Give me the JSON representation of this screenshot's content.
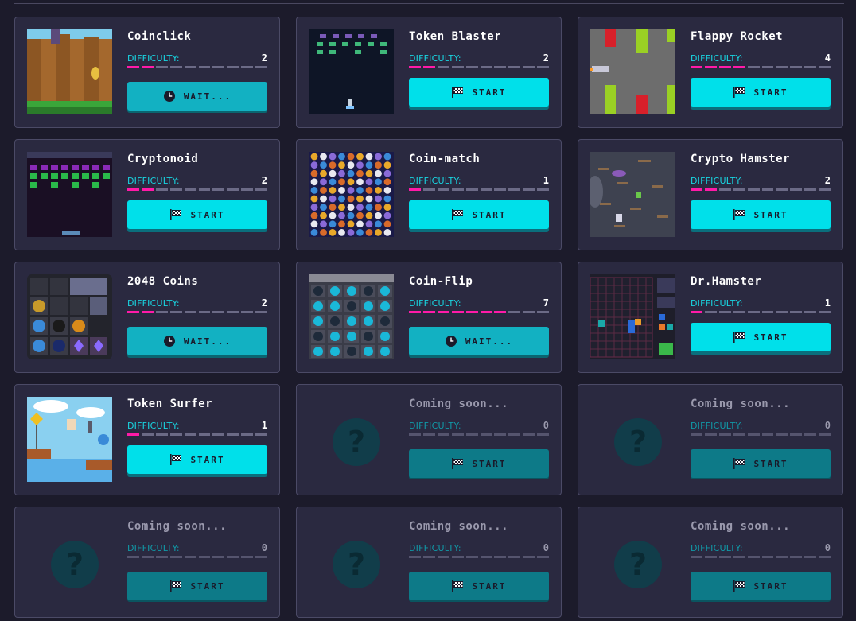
{
  "difficulty_label": "DIFFICULTY:",
  "colors": {
    "background": "#1c1b2b",
    "card": "#2a2940",
    "accent": "#00e0ea",
    "difficulty_on": "#ff1aa8"
  },
  "games": [
    {
      "title": "Coinclick",
      "difficulty": "2",
      "level": 2,
      "button": "WAIT...",
      "state": "wait",
      "thumb": "coinclick-art"
    },
    {
      "title": "Token Blaster",
      "difficulty": "2",
      "level": 2,
      "button": "START",
      "state": "start",
      "thumb": "space-shooter-art"
    },
    {
      "title": "Flappy Rocket",
      "difficulty": "4",
      "level": 4,
      "button": "START",
      "state": "start",
      "thumb": "pipes-art"
    },
    {
      "title": "Cryptonoid",
      "difficulty": "2",
      "level": 2,
      "button": "START",
      "state": "start",
      "thumb": "breakout-art"
    },
    {
      "title": "Coin-match",
      "difficulty": "1",
      "level": 1,
      "button": "START",
      "state": "start",
      "thumb": "match-grid-art"
    },
    {
      "title": "Crypto Hamster",
      "difficulty": "2",
      "level": 2,
      "button": "START",
      "state": "start",
      "thumb": "platform-art"
    },
    {
      "title": "2048 Coins",
      "difficulty": "2",
      "level": 2,
      "button": "WAIT...",
      "state": "wait",
      "thumb": "2048-grid-art"
    },
    {
      "title": "Coin-Flip",
      "difficulty": "7",
      "level": 7,
      "button": "WAIT...",
      "state": "wait",
      "thumb": "flip-grid-art"
    },
    {
      "title": "Dr.Hamster",
      "difficulty": "1",
      "level": 1,
      "button": "START",
      "state": "start",
      "thumb": "puzzle-art"
    },
    {
      "title": "Token Surfer",
      "difficulty": "1",
      "level": 1,
      "button": "START",
      "state": "start",
      "thumb": "runner-art"
    },
    {
      "title": "Coming soon...",
      "difficulty": "0",
      "level": 0,
      "button": "START",
      "state": "soon",
      "thumb": "question-icon"
    },
    {
      "title": "Coming soon...",
      "difficulty": "0",
      "level": 0,
      "button": "START",
      "state": "soon",
      "thumb": "question-icon"
    },
    {
      "title": "Coming soon...",
      "difficulty": "0",
      "level": 0,
      "button": "START",
      "state": "soon",
      "thumb": "question-icon"
    },
    {
      "title": "Coming soon...",
      "difficulty": "0",
      "level": 0,
      "button": "START",
      "state": "soon",
      "thumb": "question-icon"
    },
    {
      "title": "Coming soon...",
      "difficulty": "0",
      "level": 0,
      "button": "START",
      "state": "soon",
      "thumb": "question-icon"
    }
  ],
  "placeholder_glyph": "?"
}
